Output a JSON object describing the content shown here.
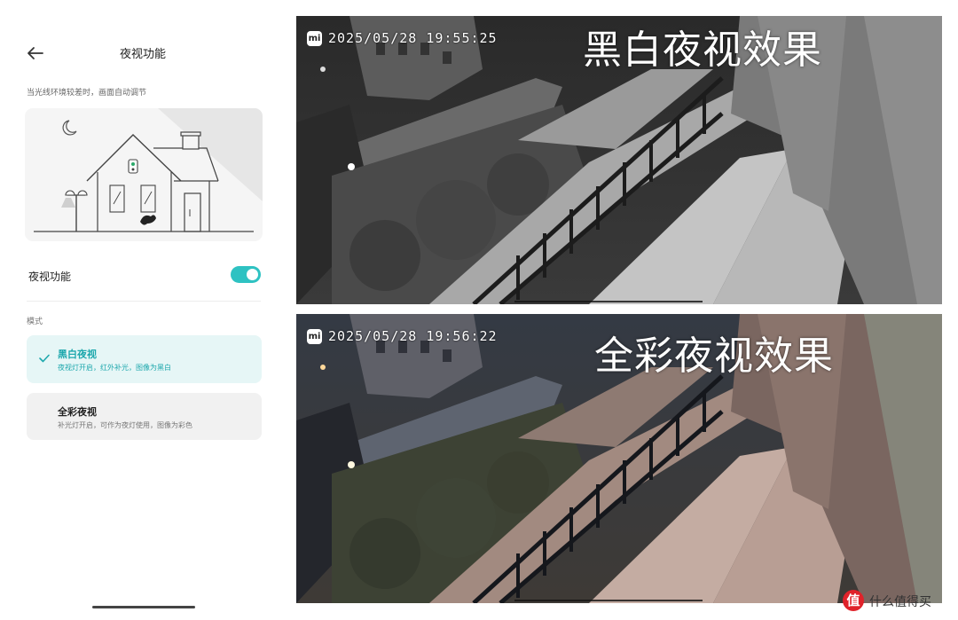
{
  "settings_panel": {
    "title": "夜视功能",
    "hint": "当光线环境较差时，画面自动调节",
    "toggle": {
      "label": "夜视功能",
      "state": "on"
    },
    "mode_section_label": "模式",
    "modes": [
      {
        "title": "黑白夜视",
        "description": "夜视灯开启，红外补光，图像为黑白",
        "selected": true
      },
      {
        "title": "全彩夜视",
        "description": "补光灯开启，可作为夜灯使用，图像为彩色",
        "selected": false
      }
    ]
  },
  "camera_views": [
    {
      "logo": "mi",
      "timestamp": "2025/05/28  19:55:25",
      "caption": "黑白夜视效果"
    },
    {
      "logo": "mi",
      "timestamp": "2025/05/28  19:56:22",
      "caption": "全彩夜视效果"
    }
  ],
  "watermark": {
    "text": "什么值得买",
    "icon": "值"
  },
  "colors": {
    "accent": "#2ec2c2",
    "selected_card_bg": "#e6f6f6"
  }
}
